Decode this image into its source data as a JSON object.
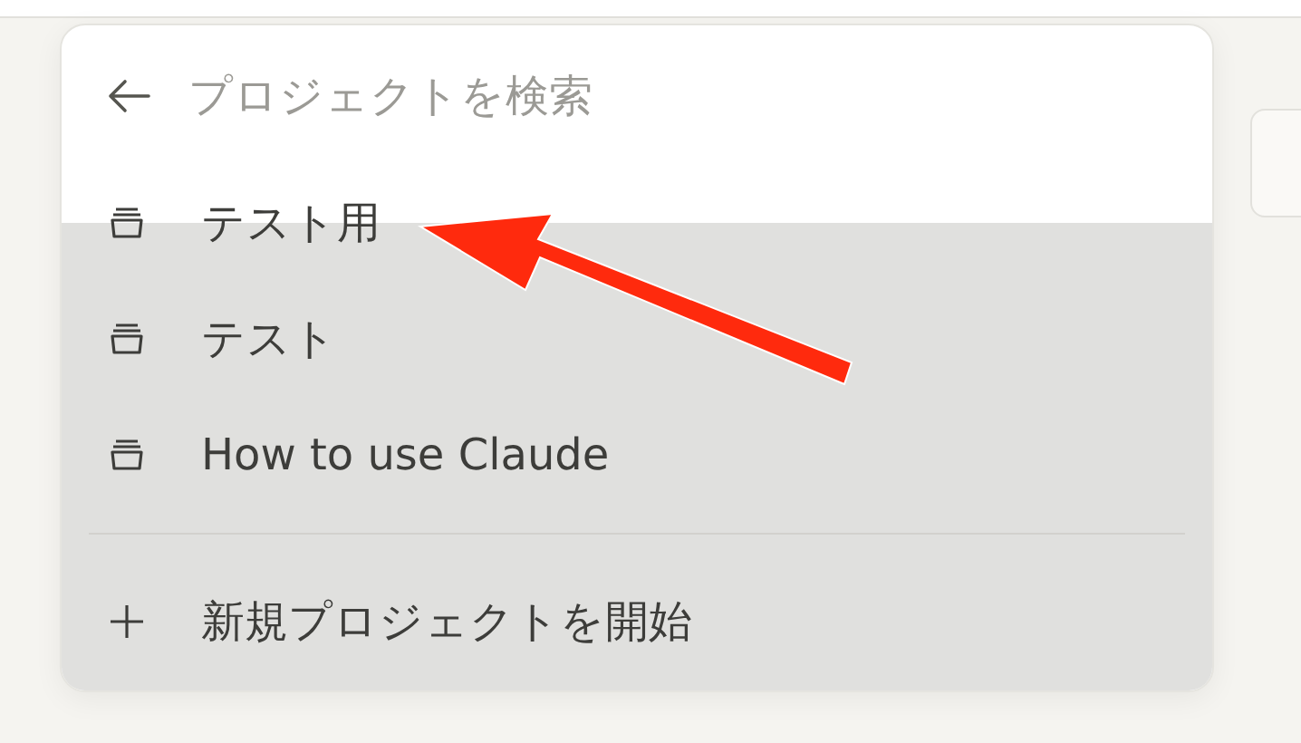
{
  "search": {
    "placeholder": "プロジェクトを検索"
  },
  "projects": [
    {
      "name": "テスト用"
    },
    {
      "name": "テスト"
    },
    {
      "name": "How to use Claude"
    }
  ],
  "new_project": {
    "label": "新規プロジェクトを開始"
  }
}
